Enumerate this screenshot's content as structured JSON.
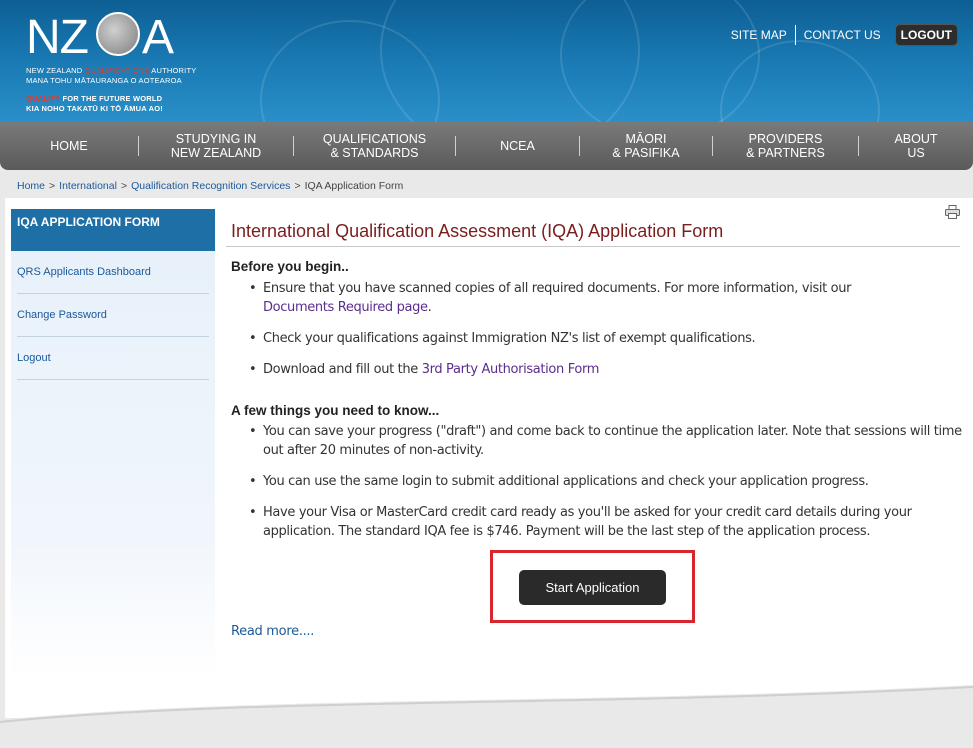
{
  "header": {
    "logo": {
      "letters_left": "NZ",
      "letters_right": "A",
      "line1_a": "NEW ZEALAND ",
      "line1_b": "QUALIFICATIONS",
      "line1_c": " AUTHORITY",
      "line2": "MANA TOHU MĀTAURANGA O AOTEAROA",
      "line3_a": "QUALIFY",
      "line3_b": " FOR THE FUTURE WORLD",
      "line4": "KIA NOHO TAKATŪ KI TŌ ĀMUA AO!"
    },
    "links": {
      "site_map": "SITE MAP",
      "contact_us": "CONTACT US",
      "logout": "LOGOUT"
    }
  },
  "nav": {
    "items": [
      {
        "line1": "HOME",
        "line2": ""
      },
      {
        "line1": "STUDYING IN",
        "line2": "NEW ZEALAND"
      },
      {
        "line1": "QUALIFICATIONS",
        "line2": "& STANDARDS"
      },
      {
        "line1": "NCEA",
        "line2": ""
      },
      {
        "line1": "MĀORI",
        "line2": "& PASIFIKA"
      },
      {
        "line1": "PROVIDERS",
        "line2": "& PARTNERS"
      },
      {
        "line1": "ABOUT",
        "line2": "US"
      }
    ]
  },
  "breadcrumb": {
    "home": "Home",
    "international": "International",
    "qrs": "Qualification Recognition Services",
    "current": "IQA Application Form",
    "separator": ">"
  },
  "sidebar": {
    "title": "IQA APPLICATION FORM",
    "items": [
      {
        "label": "QRS Applicants Dashboard"
      },
      {
        "label": "Change Password"
      },
      {
        "label": "Logout"
      }
    ]
  },
  "main": {
    "title": "International Qualification Assessment (IQA) Application Form",
    "before_heading": "Before you begin..",
    "before_items": {
      "b1_text": "Ensure that you have scanned copies of all required documents. For more information, visit our",
      "b1_link": "Documents Required page",
      "b1_end": ".",
      "b2_text": "Check your qualifications against Immigration NZ's list of exempt qualifications.",
      "b3_text": "Download and fill out the ",
      "b3_link": "3rd Party Authorisation Form"
    },
    "know_heading": "A few things you need to know...",
    "know_items": [
      {
        "text": "You can save your progress (\"draft\") and come back to continue the application later. Note that sessions will time out after 20 minutes of non-activity."
      },
      {
        "text": "You can use the same login to submit additional applications and check your application progress."
      },
      {
        "text": "Have your Visa or MasterCard credit card ready as you'll be asked for your credit card details during your application. The standard IQA fee is $746. Payment will be the last step of the application process."
      }
    ],
    "start_button": "Start Application",
    "read_more": "Read more...."
  },
  "colors": {
    "header_blue": "#1b7cb6",
    "nav_gray": "#6a6a6a",
    "title_maroon": "#7a1d1d",
    "link_blue": "#1a5a9a",
    "link_purple": "#5b2d8e",
    "highlight_red": "#d9262e",
    "button_dark": "#2a2a2a"
  }
}
